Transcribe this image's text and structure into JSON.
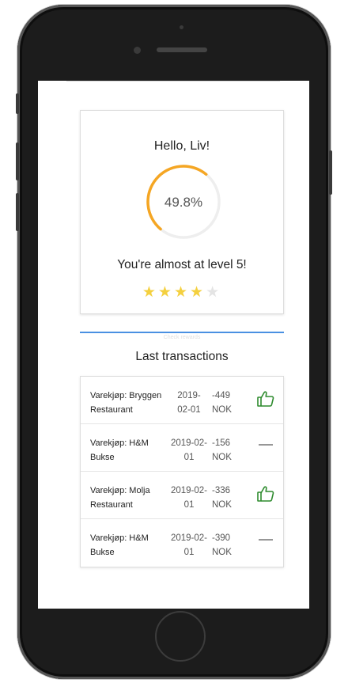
{
  "app": {
    "greeting": "Hello, Liv!",
    "progress": {
      "percent_label": "49.8%",
      "value": 0.498,
      "color": "#f5a623",
      "track_color": "#eeeeee"
    },
    "level_message": "You're almost at level 5!",
    "rating": {
      "filled": 4,
      "total": 5,
      "color": "#f4d03f"
    },
    "tab_label": "Check rewards",
    "accent_color": "#4a90e2"
  },
  "transactions": {
    "title": "Last transactions",
    "items": [
      {
        "desc_line1": "Varekjøp: Bryggen",
        "desc_line2": "Restaurant",
        "date_line1": "2019-",
        "date_line2": "02-01",
        "amount_line1": "-449",
        "amount_line2": "NOK",
        "icon": "thumbs-up-icon"
      },
      {
        "desc_line1": "Varekjøp: H&M",
        "desc_line2": "Bukse",
        "date_line1": "2019-02-",
        "date_line2": "01",
        "amount_line1": "-156",
        "amount_line2": "NOK",
        "icon": "dash-icon"
      },
      {
        "desc_line1": "Varekjøp: Molja",
        "desc_line2": "Restaurant",
        "date_line1": "2019-02-",
        "date_line2": "01",
        "amount_line1": "-336",
        "amount_line2": "NOK",
        "icon": "thumbs-up-icon"
      },
      {
        "desc_line1": "Varekjøp: H&M",
        "desc_line2": "Bukse",
        "date_line1": "2019-02-",
        "date_line2": "01",
        "amount_line1": "-390",
        "amount_line2": "NOK",
        "icon": "dash-icon"
      }
    ],
    "thumbs_color": "#2e8b2e",
    "dash_color": "#888888"
  }
}
